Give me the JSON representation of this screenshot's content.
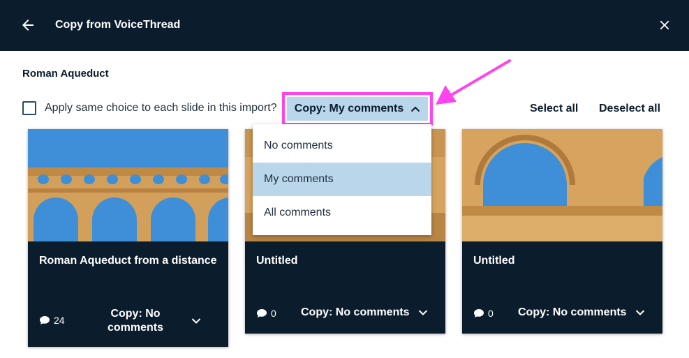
{
  "header": {
    "title": "Copy from VoiceThread"
  },
  "thread": {
    "title": "Roman Aqueduct"
  },
  "toolbar": {
    "apply_label": "Apply same choice to each slide in this import?",
    "copy_main_label": "Copy: My comments",
    "select_all": "Select all",
    "deselect_all": "Deselect all"
  },
  "dropdown": {
    "options": [
      "No comments",
      "My comments",
      "All comments"
    ],
    "selected": "My comments"
  },
  "cards": [
    {
      "title": "Roman Aqueduct from a distance",
      "comment_count": "24",
      "copy_label": "Copy: No comments"
    },
    {
      "title": "Untitled",
      "comment_count": "0",
      "copy_label": "Copy: No comments"
    },
    {
      "title": "Untitled",
      "comment_count": "0",
      "copy_label": "Copy: No comments"
    }
  ],
  "colors": {
    "header_bg": "#0b1c2c",
    "card_bg": "#0b1c2c",
    "selected_bg": "#b9d6ea",
    "highlight": "#ff44ee",
    "sky": "#3f8fd8",
    "stone": "#d7a55c"
  },
  "icons": {
    "back": "arrow-left-icon",
    "close": "close-icon",
    "comment": "comment-bubble-icon",
    "chevron_up": "chevron-up-icon",
    "chevron_down": "chevron-down-icon"
  }
}
